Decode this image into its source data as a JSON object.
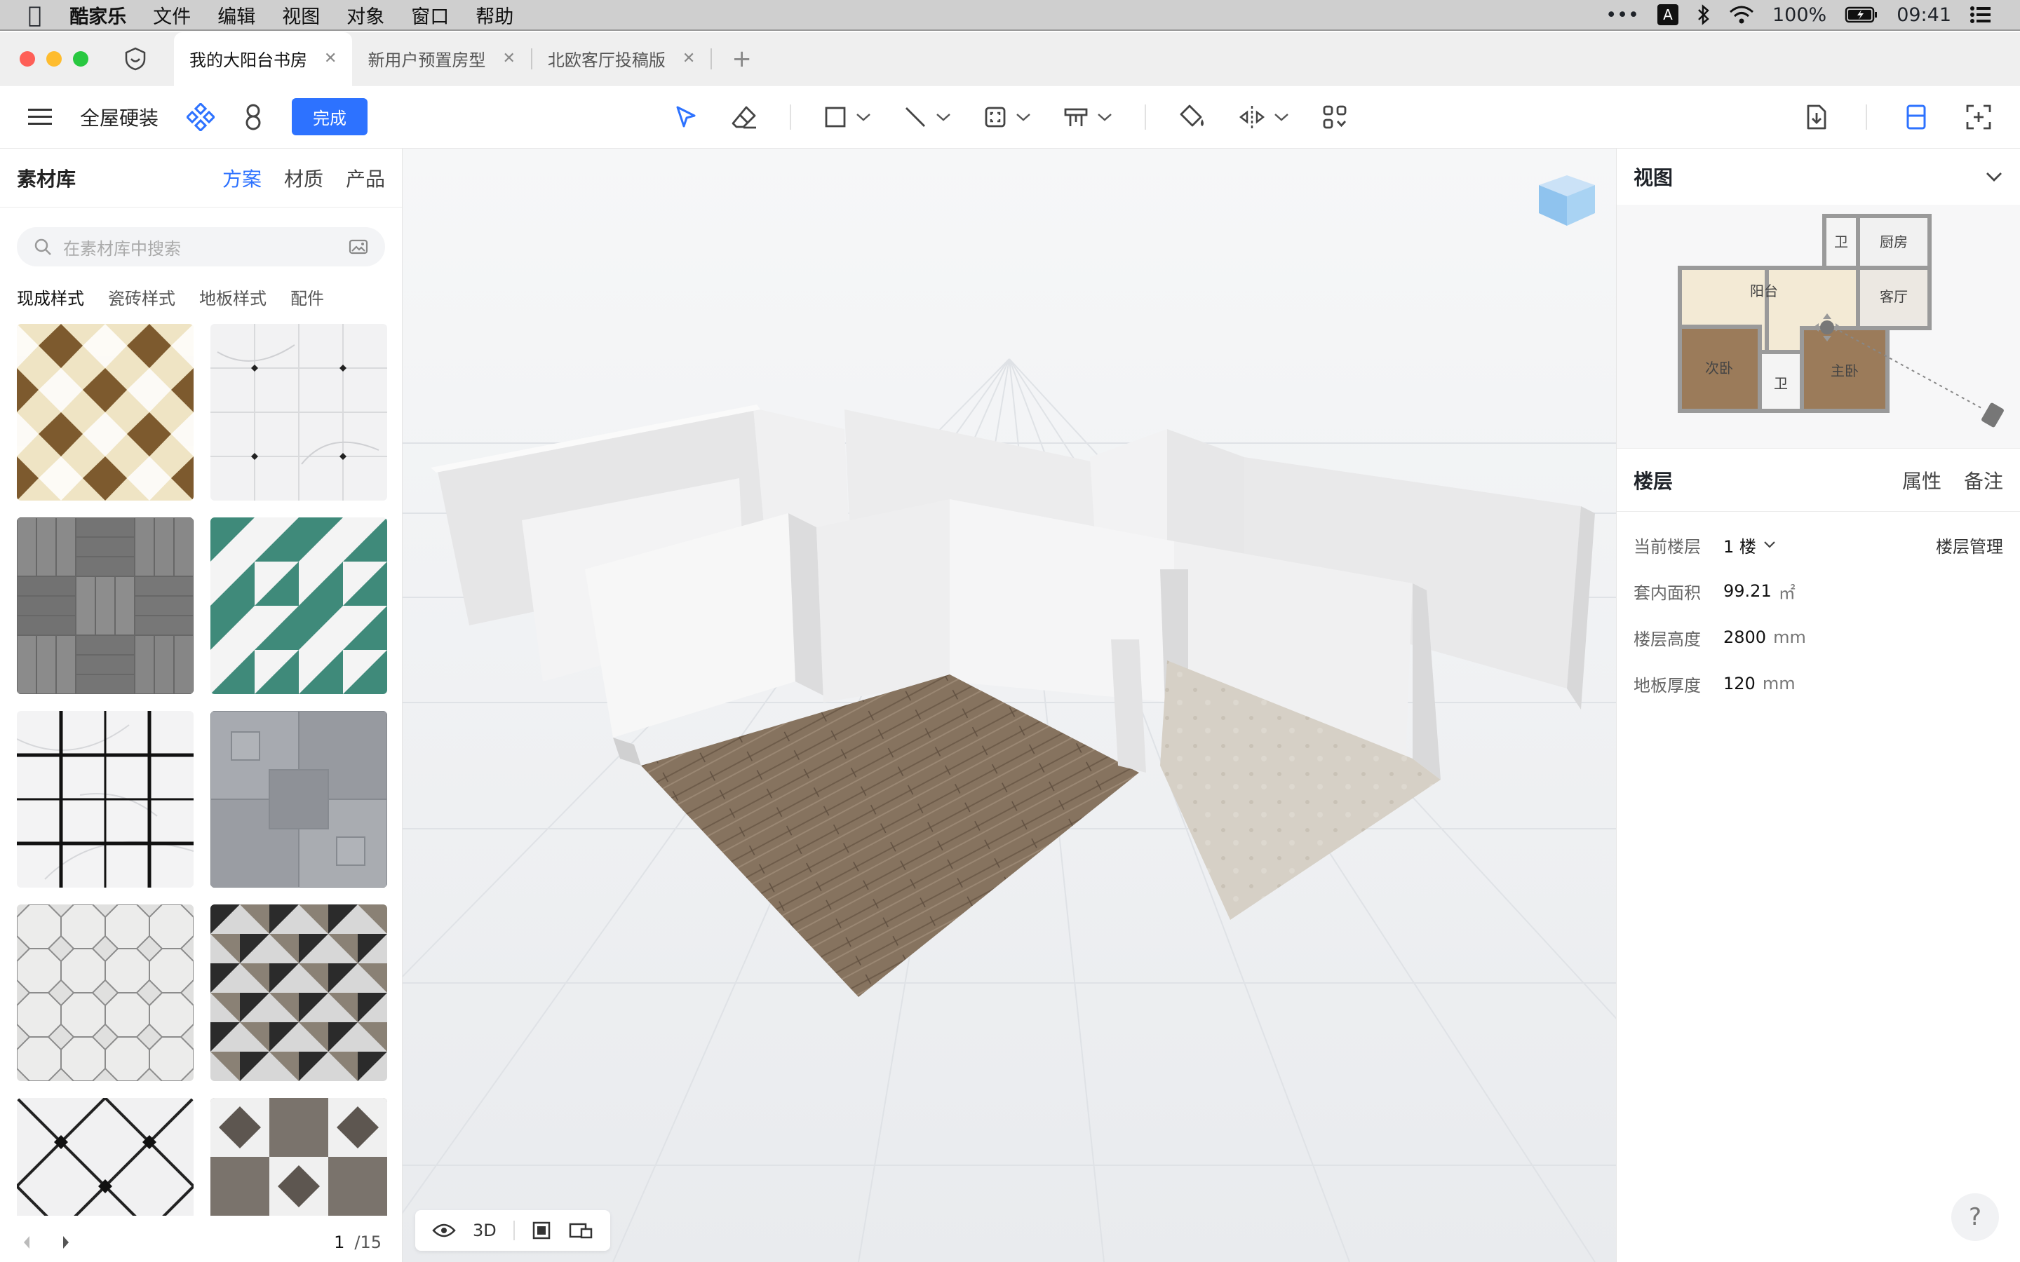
{
  "menubar": {
    "app_name": "酷家乐",
    "items": [
      "文件",
      "编辑",
      "视图",
      "对象",
      "窗口",
      "帮助"
    ],
    "input_badge": "A",
    "battery": "100%",
    "time": "09:41"
  },
  "tabs": [
    {
      "label": "我的大阳台书房",
      "active": true
    },
    {
      "label": "新用户预置房型",
      "active": false
    },
    {
      "label": "北欧客厅投稿版",
      "active": false
    }
  ],
  "toolbar": {
    "mode_label": "全屋硬装",
    "done_label": "完成"
  },
  "library": {
    "title": "素材库",
    "tabs": [
      "方案",
      "材质",
      "产品"
    ],
    "active_tab": "方案",
    "search_placeholder": "在素材库中搜索",
    "subtabs": [
      "现成样式",
      "瓷砖样式",
      "地板样式",
      "配件"
    ],
    "active_subtab": "现成样式",
    "page_current": "1",
    "page_total": "/15"
  },
  "viewport": {
    "view_mode": "3D"
  },
  "view_panel": {
    "title": "视图",
    "rooms": [
      "卫",
      "厨房",
      "阳台",
      "客厅",
      "次卧",
      "卫",
      "主卧"
    ]
  },
  "floor_panel": {
    "title": "楼层",
    "tabs": [
      "属性",
      "备注"
    ],
    "current_floor_label": "当前楼层",
    "current_floor_value": "1 楼",
    "manage_label": "楼层管理",
    "area_label": "套内面积",
    "area_value": "99.21",
    "area_unit": "㎡",
    "height_label": "楼层高度",
    "height_value": "2800",
    "height_unit": "mm",
    "thickness_label": "地板厚度",
    "thickness_value": "120",
    "thickness_unit": "mm"
  },
  "colors": {
    "accent": "#2d72ff",
    "traffic_red": "#fe5f57",
    "traffic_yellow": "#febc2e",
    "traffic_green": "#28c840"
  }
}
